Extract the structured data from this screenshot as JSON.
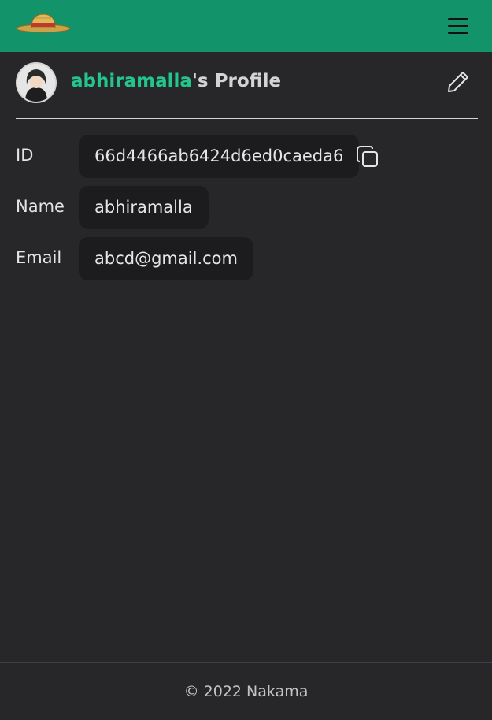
{
  "navbar": {
    "logo_icon": "straw-hat-logo",
    "menu_icon": "hamburger-menu-icon"
  },
  "profile": {
    "username": "abhiramalla",
    "title_suffix": "'s Profile",
    "avatar_icon": "user-avatar",
    "edit_icon": "pencil-icon"
  },
  "fields": {
    "id": {
      "label": "ID",
      "value": "66d4466ab6424d6ed0caeda6",
      "copy_icon": "copy-icon"
    },
    "name": {
      "label": "Name",
      "value": "abhiramalla"
    },
    "email": {
      "label": "Email",
      "value": "abcd@gmail.com"
    }
  },
  "footer": {
    "text": "© 2022 Nakama"
  },
  "colors": {
    "navbar_bg": "#13936a",
    "page_bg": "#27272a",
    "accent": "#22c58b",
    "field_bg": "#1c1c1e"
  }
}
